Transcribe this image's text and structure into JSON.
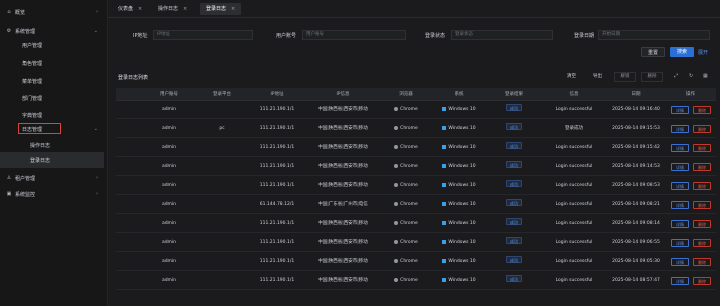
{
  "sidebar": {
    "items": [
      {
        "label": "概览",
        "icon": "home-icon"
      },
      {
        "label": "系统管理",
        "icon": "settings-icon"
      },
      {
        "label": "用户管理"
      },
      {
        "label": "角色管理"
      },
      {
        "label": "菜单管理"
      },
      {
        "label": "部门管理"
      },
      {
        "label": "字典管理"
      },
      {
        "label": "日志管理"
      },
      {
        "label": "操作日志"
      },
      {
        "label": "登录日志"
      },
      {
        "label": "租户管理",
        "icon": "users-icon"
      },
      {
        "label": "系统监控",
        "icon": "monitor-icon"
      }
    ]
  },
  "tabs": [
    {
      "label": "仪表盘"
    },
    {
      "label": "操作日志"
    },
    {
      "label": "登录日志"
    }
  ],
  "search": {
    "ip_label": "IP地址",
    "ip_placeholder": "IP地址",
    "user_label": "用户账号",
    "user_placeholder": "用户账号",
    "status_label": "登录状态",
    "status_placeholder": "登录状态",
    "date_label": "登录日期",
    "date_placeholder": "开始日期",
    "reset": "重置",
    "search": "搜索",
    "more": "展开"
  },
  "table": {
    "title": "登录日志列表",
    "tools": {
      "clean": "清空",
      "export": "导出",
      "unlock": "解锁",
      "delete": "删除"
    },
    "headers": [
      "用户账号",
      "登录平台",
      "IP地址",
      "IP信息",
      "浏览器",
      "系统",
      "登录结果",
      "信息",
      "日期",
      "操作"
    ],
    "rows": [
      {
        "user": "admin",
        "platform": "",
        "ip": "111.21.190.1/1",
        "location": "中国|陕西省|西安市|移动",
        "browser": "Chrome",
        "os": "Windows 10",
        "result": "成功",
        "msg": "Login successful",
        "date": "2025-08-14 09:16:40"
      },
      {
        "user": "admin",
        "platform": "pc",
        "ip": "111.21.190.1/1",
        "location": "中国|陕西省|西安市|移动",
        "browser": "Chrome",
        "os": "Windows 10",
        "result": "成功",
        "msg": "登录成功",
        "date": "2025-08-14 09:15:53"
      },
      {
        "user": "admin",
        "platform": "",
        "ip": "111.21.190.1/1",
        "location": "中国|陕西省|西安市|移动",
        "browser": "Chrome",
        "os": "Windows 10",
        "result": "成功",
        "msg": "Login successful",
        "date": "2025-08-14 09:15:42"
      },
      {
        "user": "admin",
        "platform": "",
        "ip": "111.21.190.1/1",
        "location": "中国|陕西省|西安市|移动",
        "browser": "Chrome",
        "os": "Windows 10",
        "result": "成功",
        "msg": "Login successful",
        "date": "2025-08-14 09:14:53"
      },
      {
        "user": "admin",
        "platform": "",
        "ip": "111.21.190.1/1",
        "location": "中国|陕西省|西安市|移动",
        "browser": "Chrome",
        "os": "Windows 10",
        "result": "成功",
        "msg": "Login successful",
        "date": "2025-08-14 09:08:53"
      },
      {
        "user": "admin",
        "platform": "",
        "ip": "61.144.78.12/1",
        "location": "中国|广东省|广州市|电信",
        "browser": "Chrome",
        "os": "Windows 10",
        "result": "成功",
        "msg": "Login successful",
        "date": "2025-08-14 09:08:21"
      },
      {
        "user": "admin",
        "platform": "",
        "ip": "111.21.190.1/1",
        "location": "中国|陕西省|西安市|移动",
        "browser": "Chrome",
        "os": "Windows 10",
        "result": "成功",
        "msg": "Login successful",
        "date": "2025-08-14 09:08:14"
      },
      {
        "user": "admin",
        "platform": "",
        "ip": "111.21.190.1/1",
        "location": "中国|陕西省|西安市|移动",
        "browser": "Chrome",
        "os": "Windows 10",
        "result": "成功",
        "msg": "Login successful",
        "date": "2025-08-14 09:06:55"
      },
      {
        "user": "admin",
        "platform": "",
        "ip": "111.21.190.1/1",
        "location": "中国|陕西省|西安市|移动",
        "browser": "Chrome",
        "os": "Windows 10",
        "result": "成功",
        "msg": "Login successful",
        "date": "2025-08-14 09:05:30"
      },
      {
        "user": "admin",
        "platform": "",
        "ip": "111.21.190.1/1",
        "location": "中国|陕西省|西安市|移动",
        "browser": "Chrome",
        "os": "Windows 10",
        "result": "成功",
        "msg": "Login successful",
        "date": "2025-08-14 08:57:47"
      }
    ],
    "action_detail": "详情",
    "action_delete": "删除"
  },
  "colors": {
    "accent": "#2b6fd6",
    "danger": "#d9433c",
    "background": "#1b1b1d"
  }
}
